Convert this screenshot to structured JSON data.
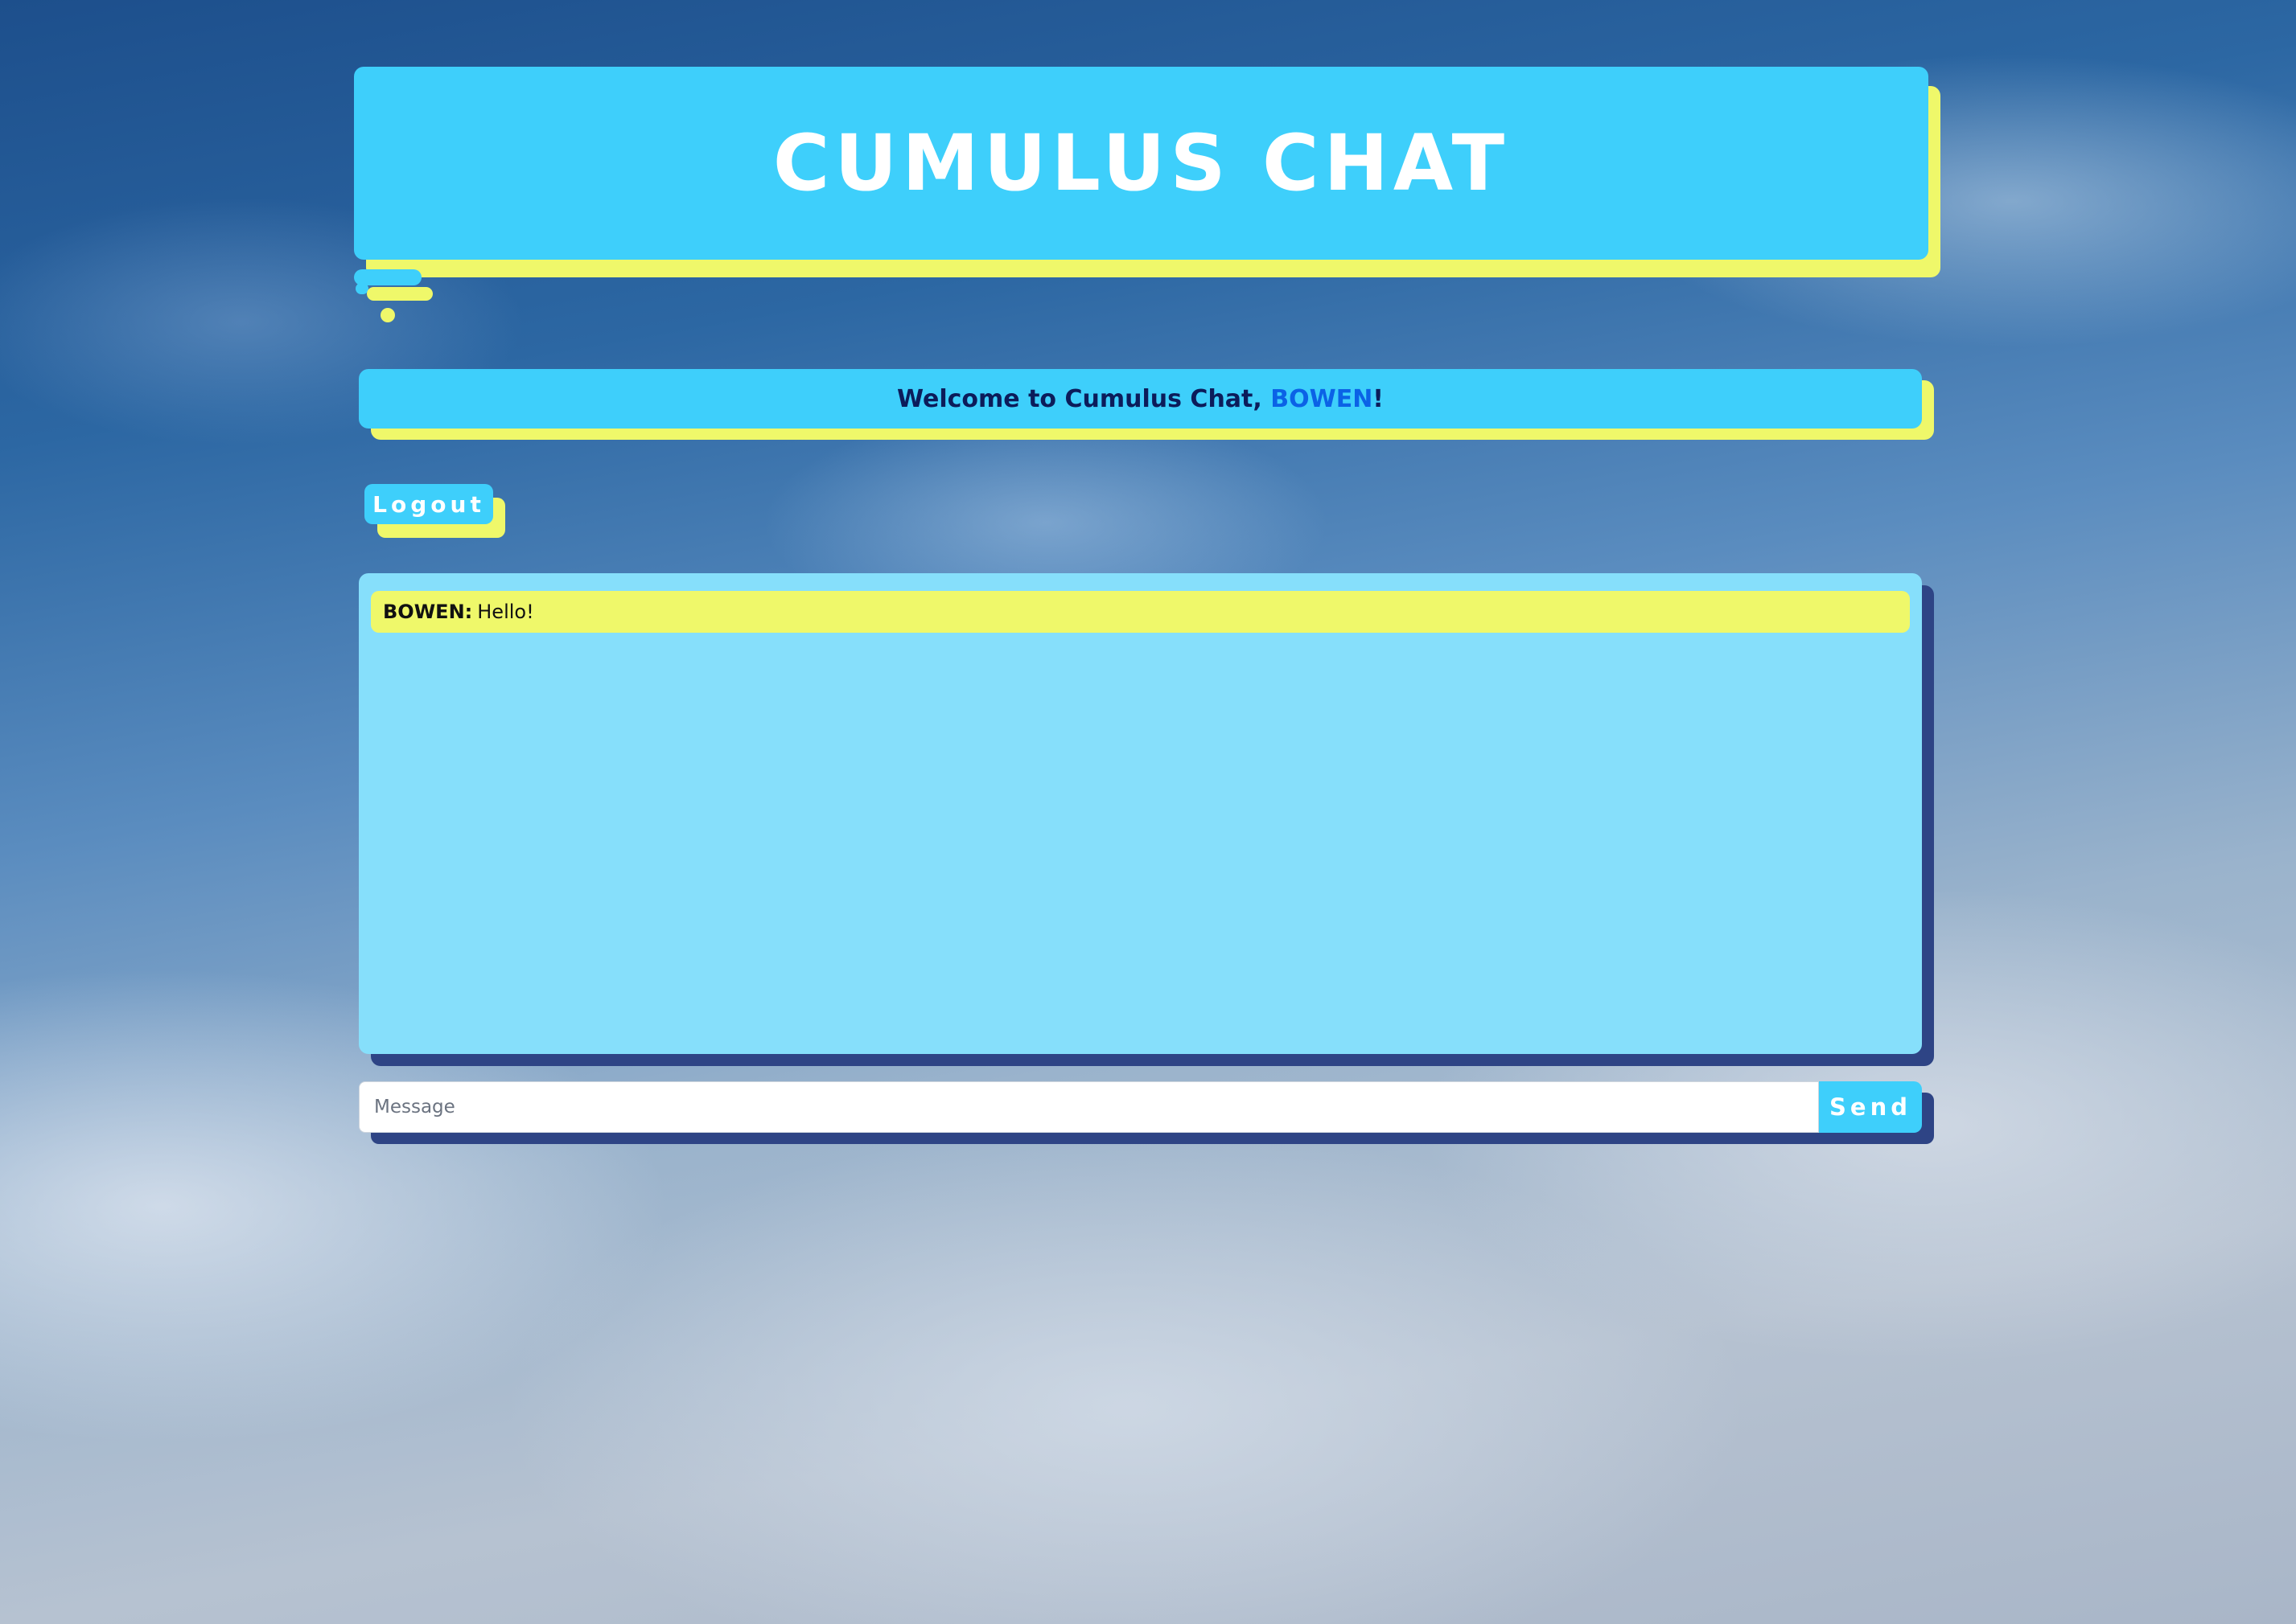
{
  "header": {
    "title": "CUMULUS CHAT"
  },
  "welcome": {
    "prefix": "Welcome to Cumulus Chat, ",
    "username": "BOWEN",
    "suffix": "!"
  },
  "logout": {
    "label": "Logout"
  },
  "chat": {
    "messages": [
      {
        "author": "BOWEN:",
        "text": "Hello!"
      }
    ]
  },
  "composer": {
    "placeholder": "Message",
    "value": "",
    "send_label": "Send"
  },
  "colors": {
    "primary": "#3ecffb",
    "accent": "#eff86a",
    "chat_bg": "#86dffb",
    "shadow_dark": "#2e4485",
    "username": "#0b62e6",
    "welcome_text": "#0c1c5a"
  }
}
